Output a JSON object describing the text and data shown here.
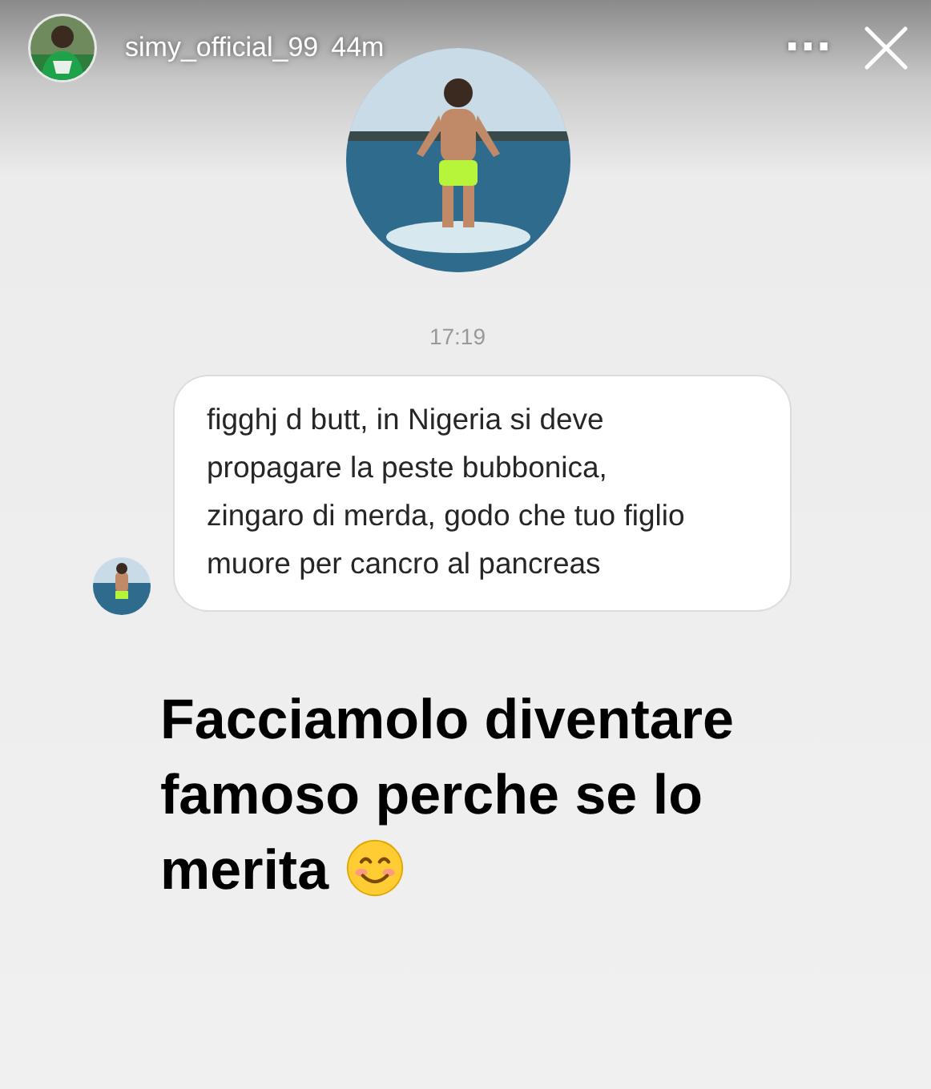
{
  "header": {
    "username": "simy_official_99",
    "time": "44m",
    "more": "···"
  },
  "timestamp": "17:19",
  "message": {
    "text": "figghj d butt, in Nigeria si deve propagare la peste bubbonica, zingaro di merda, godo che tuo figlio muore per cancro al pancreas"
  },
  "caption": "Facciamolo diventare famoso perche se lo merita"
}
